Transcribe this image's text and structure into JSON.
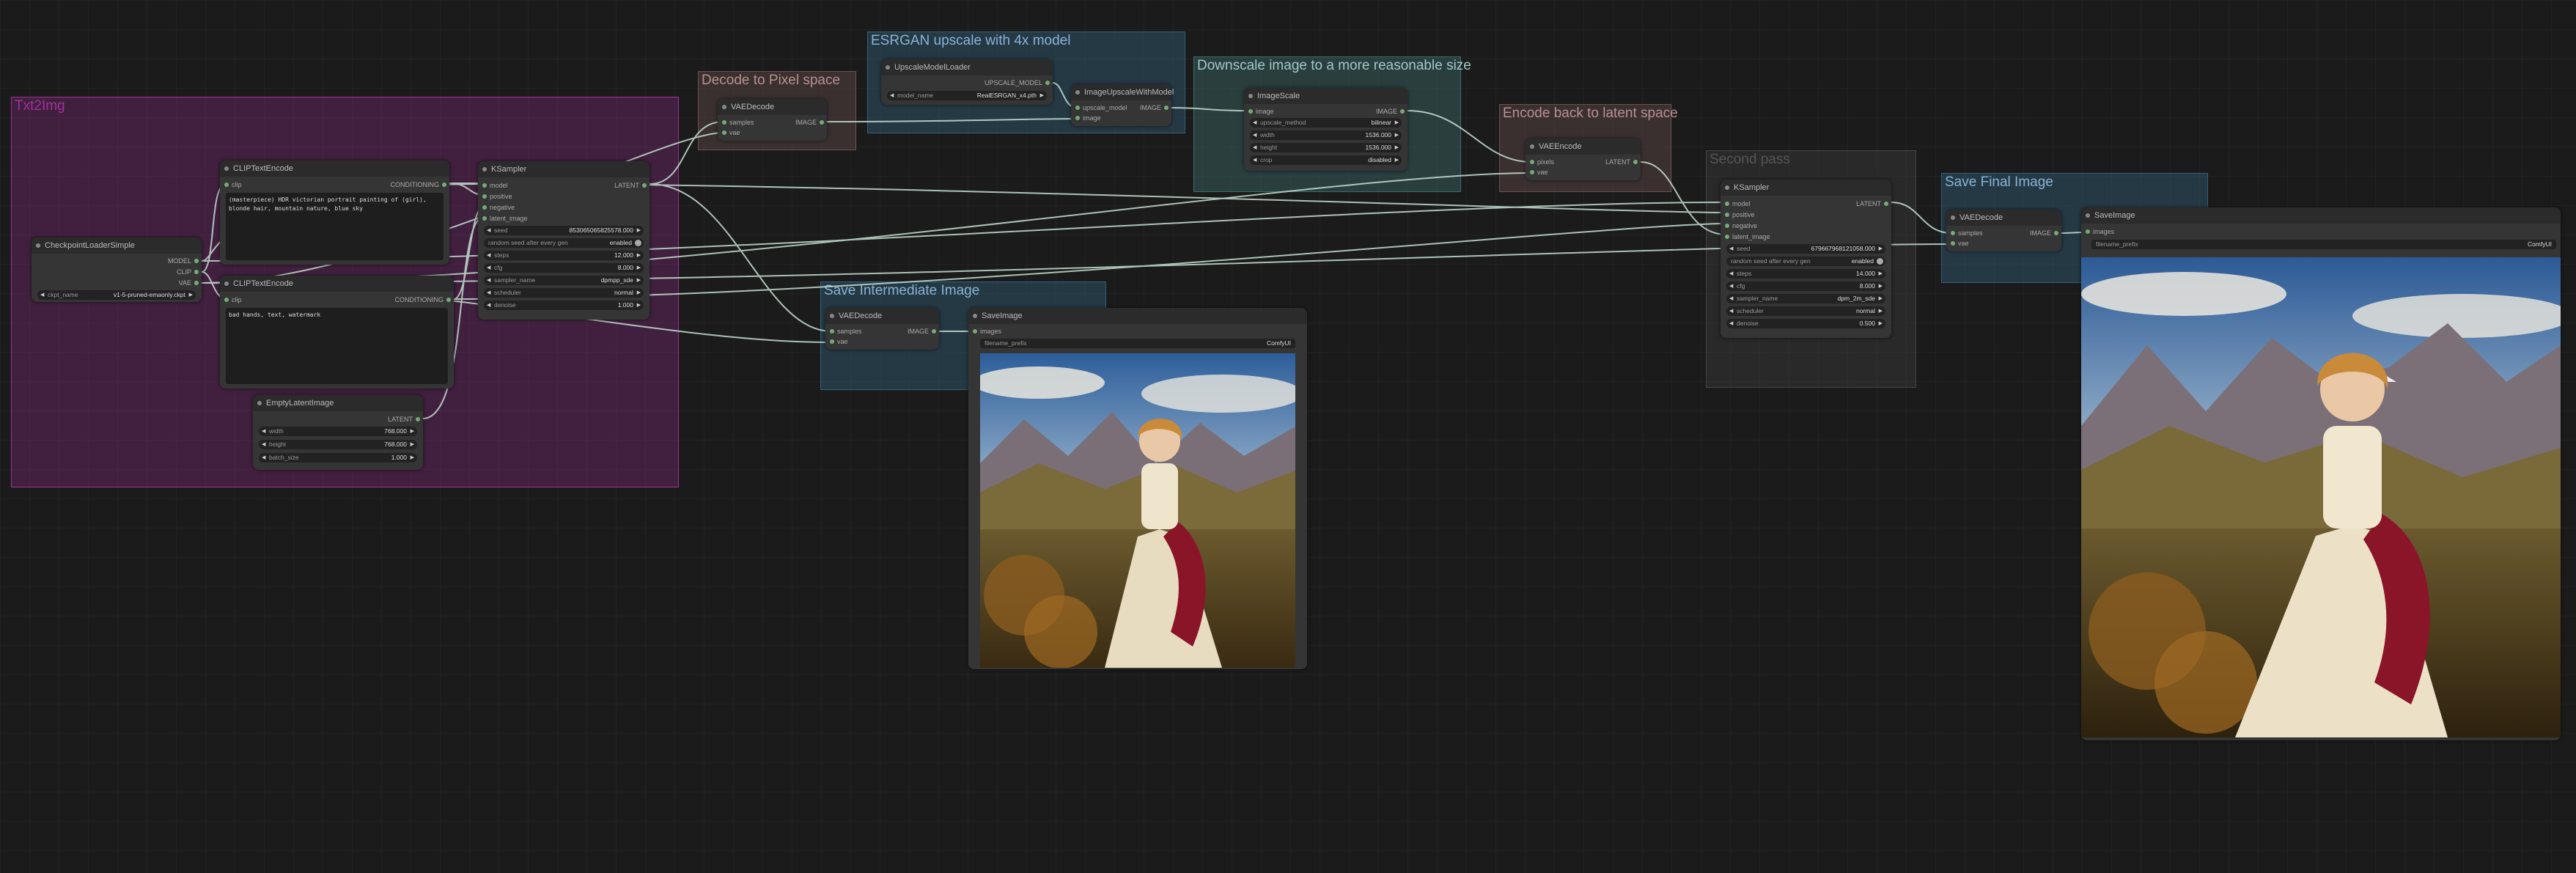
{
  "groups": {
    "txt2img": "Txt2Img",
    "decode": "Decode to Pixel space",
    "esrgan": "ESRGAN upscale with 4x model",
    "downscale": "Downscale image to a more reasonable size",
    "encode_back": "Encode back to latent space",
    "second_pass": "Second pass",
    "save_intermediate": "Save Intermediate Image",
    "save_final": "Save Final Image"
  },
  "colors": {
    "txt2img_group": "#a1309b",
    "blue_group": "#335f7a",
    "teal_group": "#3f6b6b",
    "brown_group": "#6b4f4f",
    "grey_group": "#444444"
  },
  "nodes": {
    "checkpoint": {
      "title": "CheckpointLoaderSimple",
      "out_model": "MODEL",
      "out_clip": "CLIP",
      "out_vae": "VAE",
      "ckpt_label": "ckpt_name",
      "ckpt_value": "v1-5-pruned-emaonly.ckpt"
    },
    "clip_pos": {
      "title": "CLIPTextEncode",
      "in_clip": "clip",
      "out": "CONDITIONING",
      "text": "(masterpiece) HDR victorian portrait painting of (girl), blonde hair, mountain nature, blue sky"
    },
    "clip_neg": {
      "title": "CLIPTextEncode",
      "in_clip": "clip",
      "out": "CONDITIONING",
      "text": "bad hands, text, watermark"
    },
    "empty_latent": {
      "title": "EmptyLatentImage",
      "out": "LATENT",
      "width_label": "width",
      "width_value": "768.000",
      "height_label": "height",
      "height_value": "768.000",
      "batch_label": "batch_size",
      "batch_value": "1.000"
    },
    "ksampler1": {
      "title": "KSampler",
      "in_model": "model",
      "in_positive": "positive",
      "in_negative": "negative",
      "in_latent": "latent_image",
      "out": "LATENT",
      "seed_label": "seed",
      "seed_value": "853065065825578.000",
      "random_label": "random seed after every gen",
      "random_value": "enabled",
      "steps_label": "steps",
      "steps_value": "12.000",
      "cfg_label": "cfg",
      "cfg_value": "8.000",
      "sampler_label": "sampler_name",
      "sampler_value": "dpmpp_sde",
      "scheduler_label": "scheduler",
      "scheduler_value": "normal",
      "denoise_label": "denoise",
      "denoise_value": "1.000"
    },
    "vaedecode1": {
      "title": "VAEDecode",
      "in_samples": "samples",
      "in_vae": "vae",
      "out": "IMAGE"
    },
    "upscale_loader": {
      "title": "UpscaleModelLoader",
      "out": "UPSCALE_MODEL",
      "model_label": "model_name",
      "model_value": "RealESRGAN_x4.pth"
    },
    "image_upscale": {
      "title": "ImageUpscaleWithModel",
      "in_upscale": "upscale_model",
      "in_image": "image",
      "out": "IMAGE"
    },
    "image_scale": {
      "title": "ImageScale",
      "in_image": "image",
      "out": "IMAGE",
      "method_label": "upscale_method",
      "method_value": "bilinear",
      "width_label": "width",
      "width_value": "1536.000",
      "height_label": "height",
      "height_value": "1536.000",
      "crop_label": "crop",
      "crop_value": "disabled"
    },
    "vaeencode": {
      "title": "VAEEncode",
      "in_pixels": "pixels",
      "in_vae": "vae",
      "out": "LATENT"
    },
    "ksampler2": {
      "title": "KSampler",
      "in_model": "model",
      "in_positive": "positive",
      "in_negative": "negative",
      "in_latent": "latent_image",
      "out": "LATENT",
      "seed_label": "seed",
      "seed_value": "679667968121058.000",
      "random_label": "random seed after every gen",
      "random_value": "enabled",
      "steps_label": "steps",
      "steps_value": "14.000",
      "cfg_label": "cfg",
      "cfg_value": "8.000",
      "sampler_label": "sampler_name",
      "sampler_value": "dpm_2m_sde",
      "scheduler_label": "scheduler",
      "scheduler_value": "normal",
      "denoise_label": "denoise",
      "denoise_value": "0.500"
    },
    "vaedecode_inter": {
      "title": "VAEDecode",
      "in_samples": "samples",
      "in_vae": "vae",
      "out": "IMAGE"
    },
    "save_inter": {
      "title": "SaveImage",
      "in_images": "images",
      "prefix_label": "filename_prefix",
      "prefix_value": "ComfyUI"
    },
    "vaedecode_final": {
      "title": "VAEDecode",
      "in_samples": "samples",
      "in_vae": "vae",
      "out": "IMAGE"
    },
    "save_final": {
      "title": "SaveImage",
      "in_images": "images",
      "prefix_label": "filename_prefix",
      "prefix_value": "ComfyUI"
    }
  }
}
